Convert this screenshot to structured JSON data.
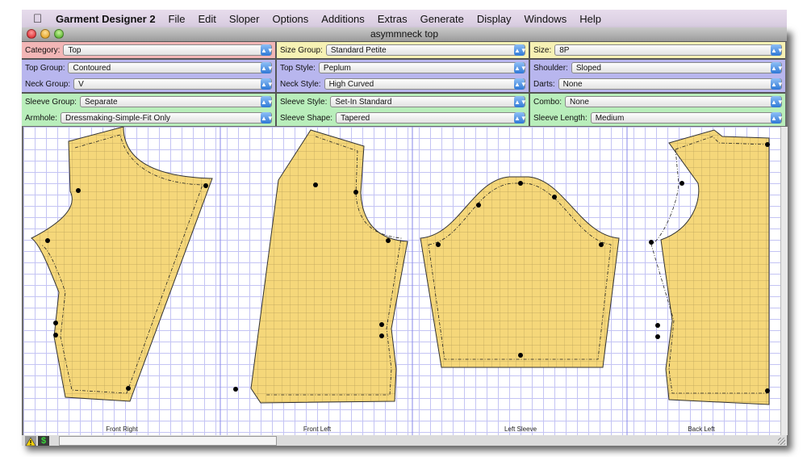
{
  "menubar": {
    "apple_icon": "apple-icon",
    "app_name": "Garment Designer 2",
    "items": [
      "File",
      "Edit",
      "Sloper",
      "Options",
      "Additions",
      "Extras",
      "Generate",
      "Display",
      "Windows",
      "Help"
    ]
  },
  "window": {
    "title": "asymmneck top",
    "controls": [
      "close",
      "minimize",
      "zoom"
    ]
  },
  "options": {
    "category": {
      "label": "Category:",
      "value": "Top"
    },
    "size_group": {
      "label": "Size Group:",
      "value": "Standard Petite"
    },
    "size": {
      "label": "Size:",
      "value": "8P"
    },
    "top_group": {
      "label": "Top Group:",
      "value": "Contoured"
    },
    "top_style": {
      "label": "Top Style:",
      "value": "Peplum"
    },
    "shoulder": {
      "label": "Shoulder:",
      "value": "Sloped"
    },
    "neck_group": {
      "label": "Neck Group:",
      "value": "V"
    },
    "neck_style": {
      "label": "Neck Style:",
      "value": "High Curved"
    },
    "darts": {
      "label": "Darts:",
      "value": "None"
    },
    "sleeve_group": {
      "label": "Sleeve Group:",
      "value": "Separate"
    },
    "sleeve_style": {
      "label": "Sleeve Style:",
      "value": "Set-In Standard"
    },
    "combo": {
      "label": "Combo:",
      "value": "None"
    },
    "armhole": {
      "label": "Armhole:",
      "value": "Dressmaking-Simple-Fit Only"
    },
    "sleeve_shape": {
      "label": "Sleeve Shape:",
      "value": "Tapered"
    },
    "sleeve_length": {
      "label": "Sleeve Length:",
      "value": "Medium"
    }
  },
  "colors": {
    "category_row": "#f2b6b6",
    "size_row": "#f6f1b4",
    "style_rows": "#b8b6ee",
    "sleeve_rows": "#b9eebb",
    "pattern_fill": "#f5d77a",
    "grid": "#c4c4f4"
  },
  "pieces": [
    {
      "name": "Front Right"
    },
    {
      "name": "Front Left"
    },
    {
      "name": "Left Sleeve"
    },
    {
      "name": "Back Left"
    }
  ],
  "statusbar": {
    "warning_icon": "warning-icon",
    "dollar_icon": "dollar-icon",
    "dollar_glyph": "$",
    "field_value": ""
  }
}
